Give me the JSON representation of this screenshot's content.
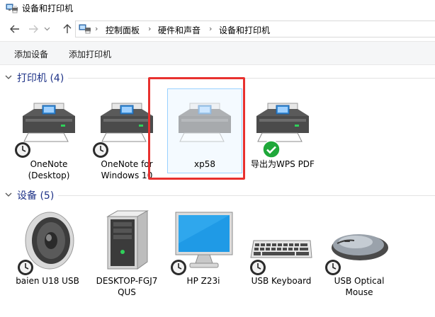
{
  "window": {
    "title": "设备和打印机"
  },
  "nav": {
    "back_icon": "arrow-left-icon",
    "forward_icon": "arrow-right-icon",
    "dropdown_icon": "chevron-down-icon",
    "up_icon": "arrow-up-icon",
    "location_icon": "devices-printers-icon",
    "breadcrumb": [
      "控制面板",
      "硬件和声音",
      "设备和打印机"
    ],
    "separator": "›"
  },
  "commands": {
    "add_device": "添加设备",
    "add_printer": "添加打印机"
  },
  "groups": {
    "printers": {
      "title": "打印机 (4)",
      "expanded": true,
      "items": [
        {
          "label": "OneNote\n(Desktop)",
          "icon": "printer-icon",
          "status": "clock-badge-icon"
        },
        {
          "label": "OneNote for\nWindows 10",
          "icon": "printer-icon",
          "status": "clock-badge-icon"
        },
        {
          "label": "xp58",
          "icon": "printer-icon",
          "status": "none",
          "selected": true
        },
        {
          "label": "导出为WPS PDF",
          "icon": "printer-icon",
          "status": "default-check-icon"
        }
      ]
    },
    "devices": {
      "title": "设备 (5)",
      "expanded": true,
      "items": [
        {
          "label": "baien U18  USB",
          "icon": "speaker-icon",
          "status": "clock-badge-icon"
        },
        {
          "label": "DESKTOP-FGJ7\nQUS",
          "icon": "computer-tower-icon",
          "status": "none"
        },
        {
          "label": "HP Z23i",
          "icon": "monitor-icon",
          "status": "clock-badge-icon"
        },
        {
          "label": "USB Keyboard",
          "icon": "keyboard-icon",
          "status": "clock-badge-icon"
        },
        {
          "label": "USB Optical\nMouse",
          "icon": "mouse-icon",
          "status": "clock-badge-icon"
        }
      ]
    }
  },
  "colors": {
    "group_title": "#1e3287",
    "highlight_border": "#e8312f",
    "selection": "#99d1ff",
    "check": "#1fa83a"
  }
}
